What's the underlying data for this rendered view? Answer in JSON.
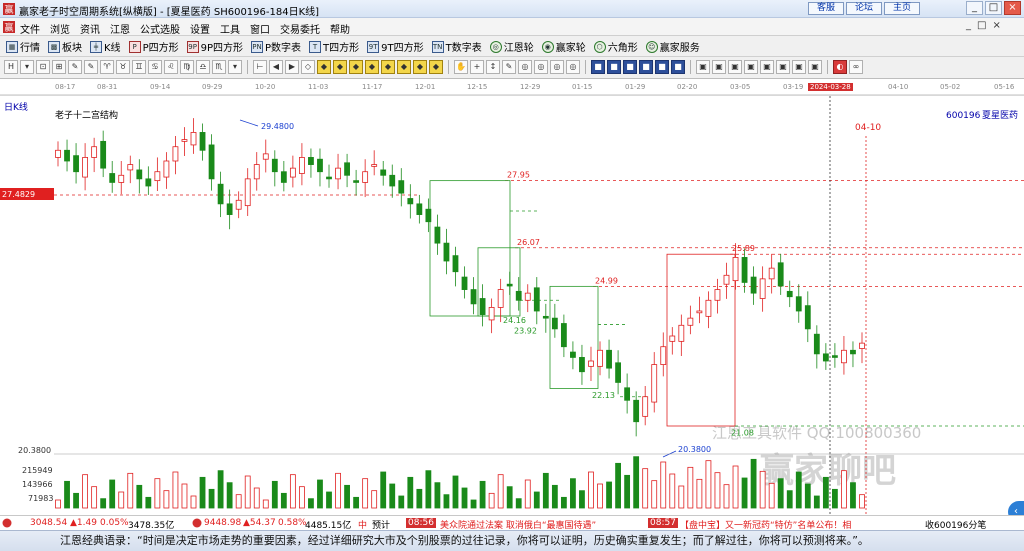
{
  "window": {
    "title": "赢家老子时空周期系统[纵横版] - [夏星医药  SH600196-184日K线]",
    "links": [
      "客服",
      "论坛",
      "主页"
    ],
    "controls": [
      "_",
      "□",
      "×"
    ]
  },
  "menu": {
    "items": [
      "文件",
      "浏览",
      "资讯",
      "江恩",
      "公式选股",
      "设置",
      "工具",
      "窗口",
      "交易委托",
      "帮助"
    ],
    "mdi_controls": [
      "_",
      "□",
      "×"
    ]
  },
  "toolbar1": {
    "items": [
      {
        "icon": "grid-icon",
        "label": "行情"
      },
      {
        "icon": "blocks-icon",
        "label": "板块"
      },
      {
        "icon": "kline-icon",
        "label": "K线"
      },
      {
        "icon": "p-icon",
        "label": "P四方形"
      },
      {
        "icon": "9p-icon",
        "label": "9P四方形"
      },
      {
        "icon": "pn-icon",
        "label": "P数字表"
      },
      {
        "icon": "t-icon",
        "label": "T四方形"
      },
      {
        "icon": "9t-icon",
        "label": "9T四方形"
      },
      {
        "icon": "tn-icon",
        "label": "T数字表"
      },
      {
        "icon": "wheel-icon",
        "label": "江恩轮"
      },
      {
        "icon": "winner-wheel-icon",
        "label": "赢家轮"
      },
      {
        "icon": "hexagon-icon",
        "label": "六角形"
      },
      {
        "icon": "service-icon",
        "label": "赢家服务"
      }
    ]
  },
  "toolbar2": {
    "groups": [
      [
        "H",
        "▾",
        "⊡",
        "⊞",
        "✎",
        "✎",
        "♈",
        "♉",
        "♊",
        "♋",
        "♌",
        "♍",
        "♎",
        "♏",
        "▾"
      ],
      [
        "⊢",
        "◀",
        "▶",
        "◇",
        "◆",
        "◆",
        "◆",
        "◆",
        "◆",
        "◆",
        "◆",
        "◆"
      ],
      [
        "✋",
        "+",
        "↕",
        "✎",
        "◎",
        "◎",
        "◎",
        "◎"
      ],
      [
        "■",
        "■",
        "■",
        "■",
        "■",
        "■"
      ],
      [
        "▣",
        "▣",
        "▣",
        "▣",
        "▣",
        "▣",
        "▣",
        "▣"
      ],
      [
        "◐",
        "∞"
      ]
    ]
  },
  "dates": [
    "08-17",
    "08-31",
    "09-14",
    "09-29",
    "10-20",
    "11-03",
    "11-17",
    "12-01",
    "12-15",
    "12-29",
    "01-15",
    "01-29",
    "02-20",
    "03-05",
    "03-19",
    "2024-03-28",
    "04-10",
    "05-02",
    "05-16"
  ],
  "chart": {
    "period_label": "日K线",
    "structure_label": "老子十二宫结构",
    "code": "600196",
    "name": "夏星医药",
    "price_marker": "27.4829",
    "crosshair_date": "04-10",
    "bottom_level": "20.3800",
    "levels": [
      "27.95",
      "26.07",
      "24.99",
      "25.89",
      "24.16",
      "23.92",
      "22.13",
      "21.08",
      "20.3800",
      "29.4800"
    ],
    "watermark_cn": "江恩工具软件 QQ:100800360",
    "watermark_logo": "赢家聊吧",
    "volume_labels": [
      "215949",
      "143966",
      "71983"
    ]
  },
  "chart_data": {
    "type": "candlestick",
    "period": "daily",
    "ylim": [
      20.38,
      29.48
    ],
    "annotations": [
      {
        "label": "29.4800",
        "price": 29.48
      },
      {
        "label": "27.95",
        "price": 27.95
      },
      {
        "label": "26.07",
        "price": 26.07
      },
      {
        "label": "25.89",
        "price": 25.89
      },
      {
        "label": "24.99",
        "price": 24.99
      },
      {
        "label": "24.16",
        "price": 24.16
      },
      {
        "label": "23.92",
        "price": 23.92
      },
      {
        "label": "22.13",
        "price": 22.13
      },
      {
        "label": "21.08",
        "price": 21.08
      },
      {
        "label": "20.3800",
        "price": 20.38
      }
    ],
    "close_series": [
      28.8,
      28.5,
      28.2,
      28.6,
      28.9,
      28.3,
      27.9,
      28.1,
      28.4,
      28.0,
      27.8,
      28.2,
      28.5,
      28.9,
      29.1,
      29.3,
      28.8,
      28.0,
      27.3,
      27.0,
      27.4,
      28.0,
      28.4,
      28.7,
      28.2,
      27.9,
      28.3,
      28.6,
      28.4,
      28.2,
      28.0,
      28.3,
      28.1,
      27.9,
      28.2,
      28.4,
      28.1,
      27.8,
      27.6,
      27.3,
      27.0,
      26.8,
      26.2,
      25.7,
      25.4,
      24.9,
      24.5,
      24.2,
      24.4,
      24.9,
      25.0,
      24.6,
      24.8,
      24.3,
      24.1,
      23.8,
      23.3,
      23.0,
      22.6,
      22.9,
      23.2,
      22.7,
      22.3,
      21.8,
      21.2,
      21.9,
      22.8,
      23.3,
      23.6,
      23.9,
      24.1,
      24.3,
      24.6,
      24.9,
      25.3,
      25.8,
      25.1,
      24.8,
      25.2,
      25.5,
      25.0,
      24.7,
      24.3,
      23.8,
      23.1,
      22.9,
      23.0,
      23.2,
      23.1,
      23.4
    ],
    "volume_ylim": [
      0,
      215949
    ]
  },
  "status": {
    "sh_index": "3048.54",
    "sh_change": "▲1.49",
    "sh_pct": "0.05%",
    "sh_amount": "3478.35亿",
    "sz_index": "9448.98",
    "sz_change": "▲54.37",
    "sz_pct": "0.58%",
    "sz_amount": "4485.15亿",
    "zhong": "中",
    "forecast": "预计",
    "time1": "08:56",
    "news1": "美众院通过法案 取消俄白“最惠国待遇”",
    "time2": "08:57",
    "news2": "【盘中宝】又一新冠药“特仿”名单公布！相",
    "tail": "收600196分笔"
  },
  "quote": {
    "text": "江恩经典语录：“时间是决定市场走势的重要因素，经过详细研究大市及个别股票的过往记录，你将可以证明，历史确实重复发生；而了解过往，你将可以预测将来。”。"
  }
}
